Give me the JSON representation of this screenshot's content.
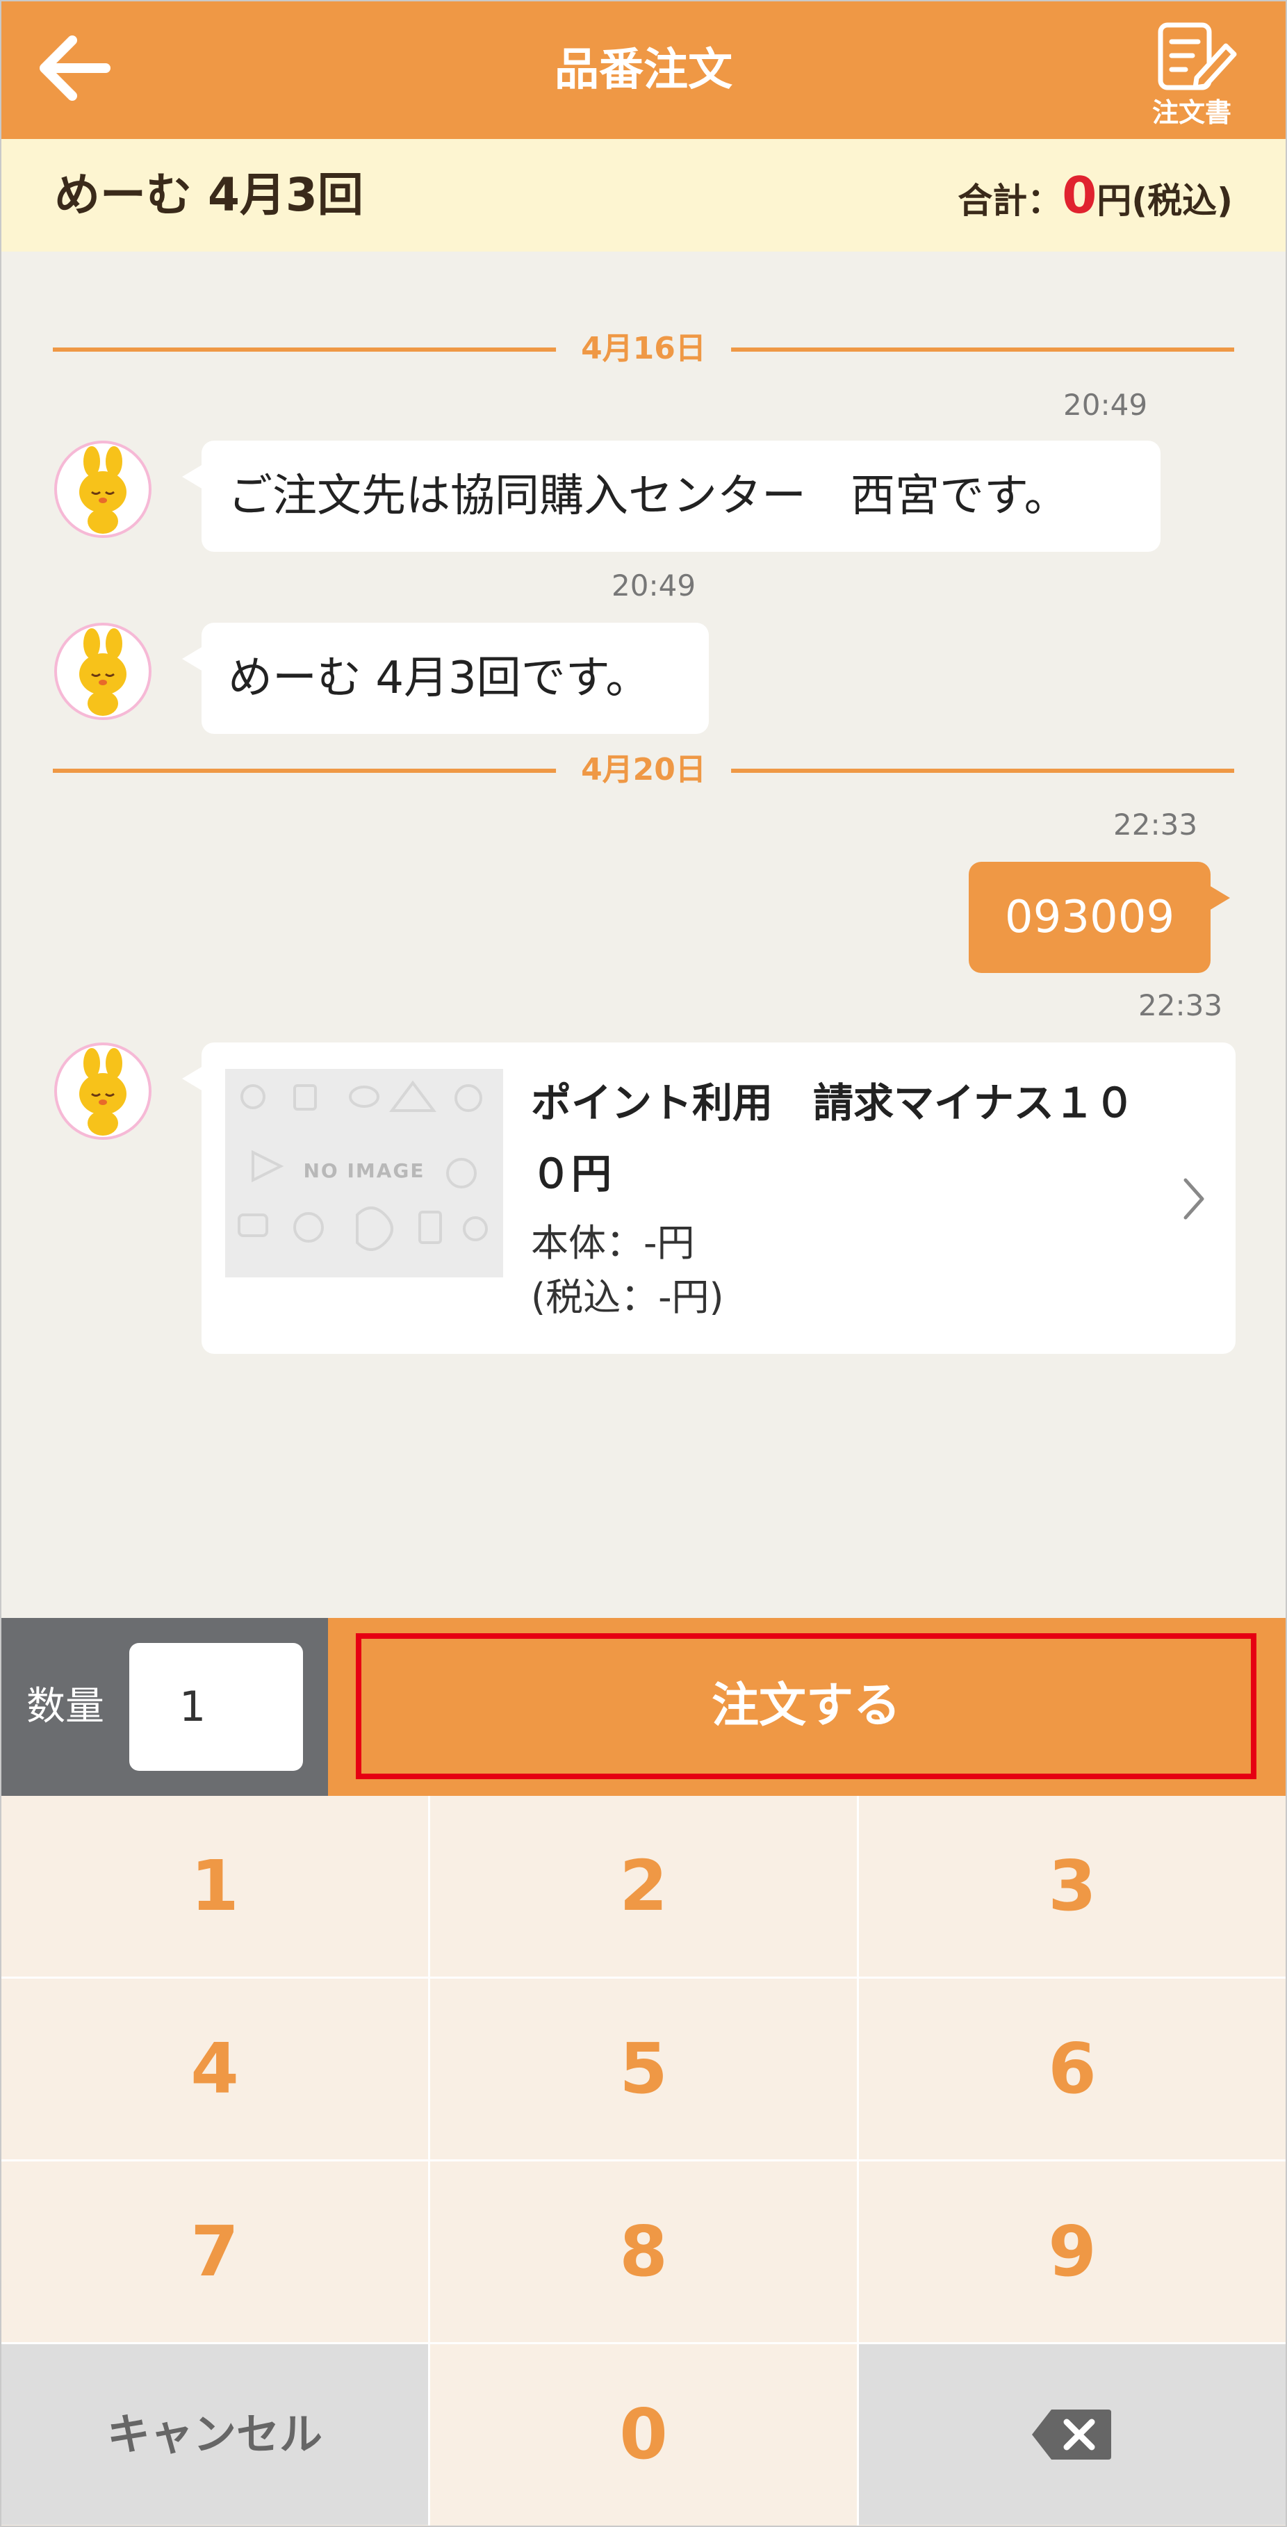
{
  "header": {
    "title": "品番注文",
    "order_doc_label": "注文書",
    "back_icon": "arrow-left-icon",
    "doc_icon": "edit-document-icon"
  },
  "summary": {
    "name": "めーむ 4月3回",
    "total_label": "合計：",
    "total_amount": "0",
    "total_suffix": "円(税込)"
  },
  "chat": {
    "dates": [
      "4月16日",
      "4月20日"
    ],
    "messages": [
      {
        "time": "20:49",
        "text": "ご注文先は協同購入センター　西宮です。"
      },
      {
        "time": "20:49",
        "text": "めーむ 4月3回です。"
      },
      {
        "time": "22:33",
        "text": "093009"
      },
      {
        "time": "22:33"
      }
    ],
    "product": {
      "image_placeholder": "NO IMAGE",
      "name": "ポイント利用　請求マイナス１００円",
      "price_body": "本体：-円",
      "price_tax": "(税込：-円)"
    }
  },
  "order_bar": {
    "qty_label": "数量",
    "qty_value": "1",
    "order_button": "注文する"
  },
  "keypad": {
    "keys": [
      "1",
      "2",
      "3",
      "4",
      "5",
      "6",
      "7",
      "8",
      "9",
      "キャンセル",
      "0"
    ],
    "delete_icon": "backspace-icon"
  },
  "colors": {
    "accent": "#ef9845",
    "highlight_border": "#e60012",
    "total_red": "#e0232f"
  }
}
